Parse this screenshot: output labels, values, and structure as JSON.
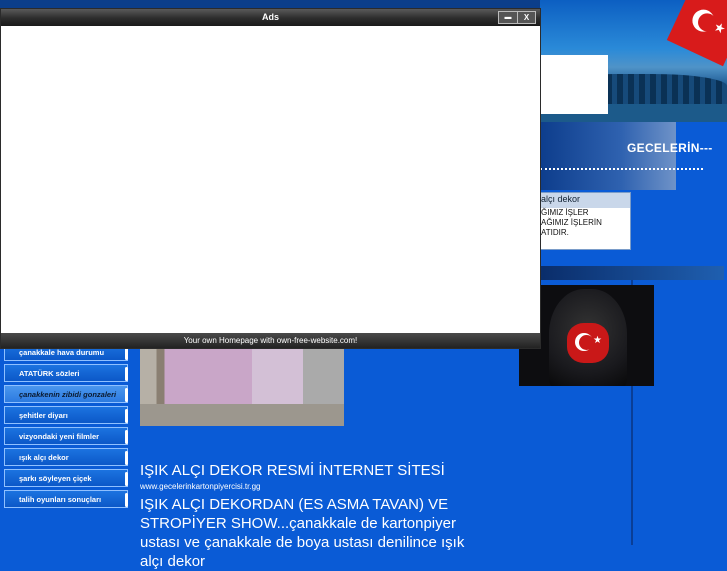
{
  "ads_window": {
    "title": "Ads",
    "minimize_label": "▬",
    "close_label": "X",
    "footer": "Your own Homepage with own-free-website.com!"
  },
  "header": {
    "title": "GECELERİN---"
  },
  "side_panel": {
    "heading": "alçı dekor",
    "lines": [
      "ĞIMIZ İŞLER",
      "AĞIMIZ İŞLERİN",
      "ATIDIR."
    ]
  },
  "nav": {
    "items": [
      {
        "label": "çanakkale hava durumu"
      },
      {
        "label": "ATATÜRK sözleri"
      },
      {
        "label": "çanakkenin zibidi gonzaleri"
      },
      {
        "label": "şehitler diyarı"
      },
      {
        "label": "vizyondaki yeni filmler"
      },
      {
        "label": "ışık alçı dekor"
      },
      {
        "label": "şarkı söyleyen çiçek"
      },
      {
        "label": "talih oyunları sonuçları"
      }
    ]
  },
  "main": {
    "title": "IŞIK ALÇI DEKOR RESMİ İNTERNET SİTESİ",
    "url": "www.gecelerinkartonpiyercisi.tr.gg",
    "body": "IŞIK ALÇI DEKORDAN  (ES ASMA TAVAN) VE STROPİYER SHOW...çanakkale de kartonpiyer ustası ve çanakkale de boya ustası denilince ışık alçı dekor"
  },
  "colors": {
    "background": "#0a5bd6",
    "window_titlebar": "#2c2c2c",
    "flag_red": "#d81b1b"
  }
}
